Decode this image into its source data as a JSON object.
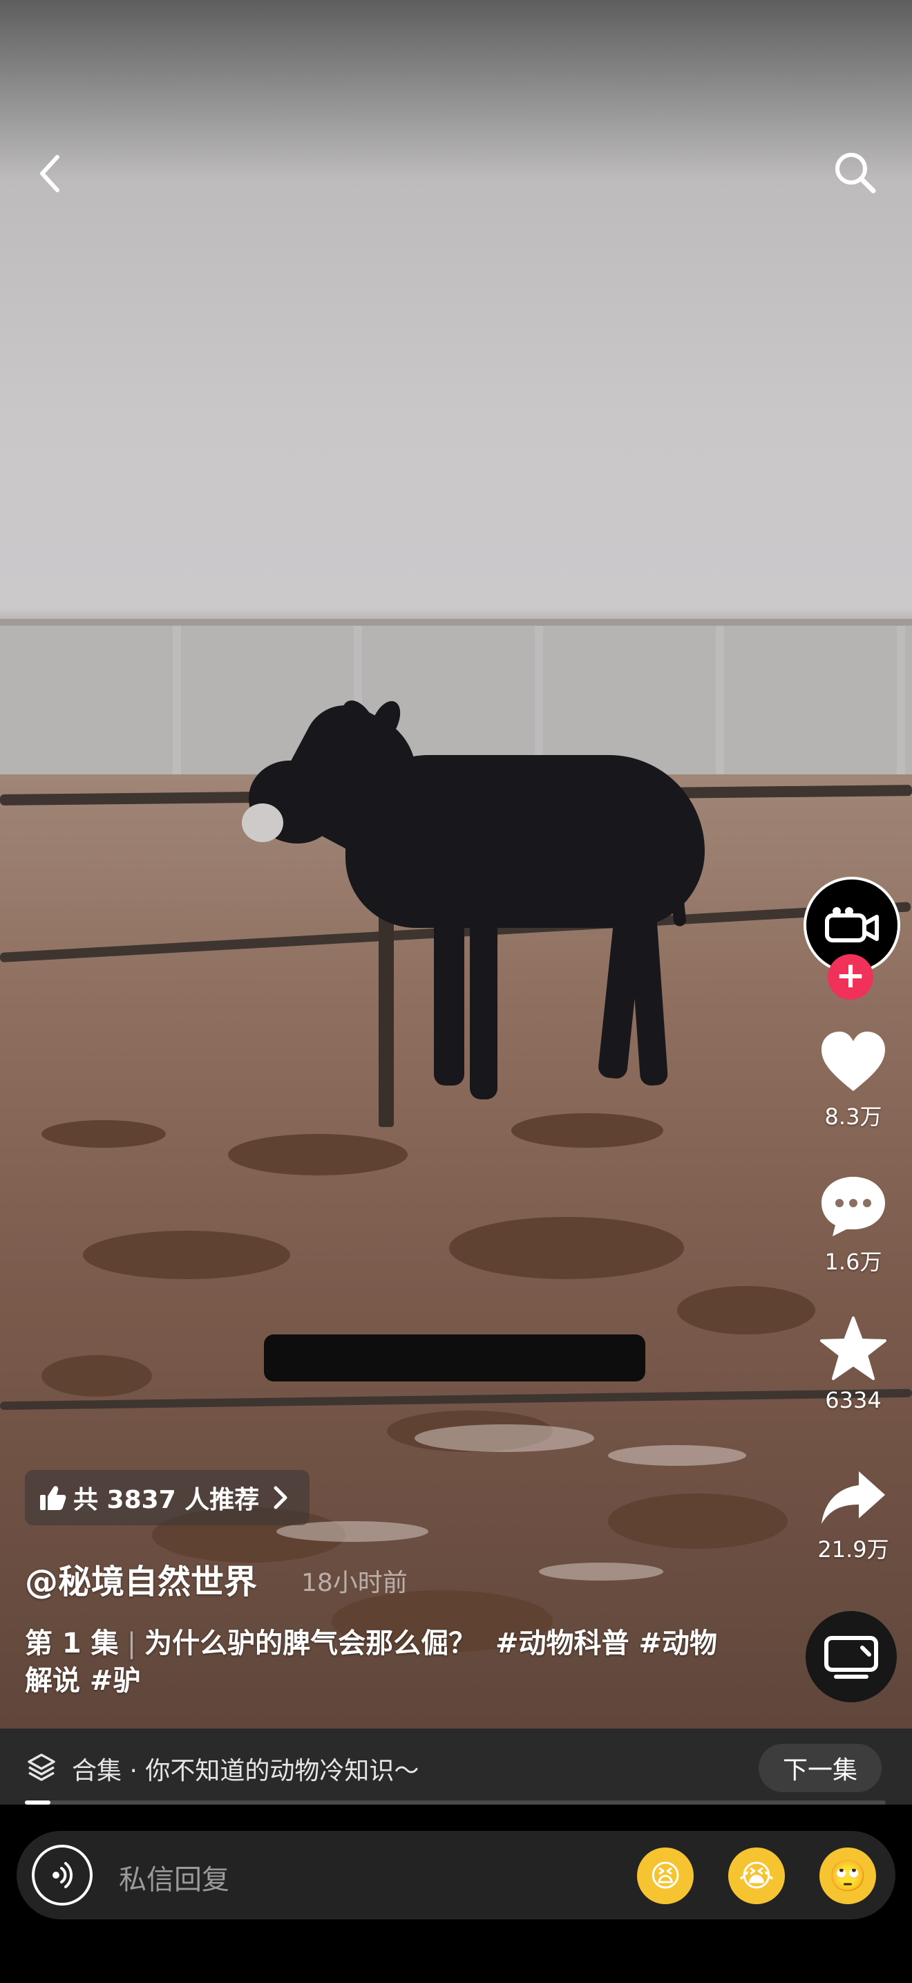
{
  "top_bar": {
    "back_icon": "chevron-left-icon",
    "search_icon": "search-icon"
  },
  "video": {
    "scene": "black donkey behind a fence in a muddy, rainy pen"
  },
  "right_rail": {
    "avatar_icon": "video-camera-icon",
    "follow_icon": "plus-icon",
    "like_count": "8.3万",
    "comment_count": "1.6万",
    "favorite_count": "6334",
    "share_count": "21.9万",
    "disc_icon": "tv-icon"
  },
  "recommend": {
    "text": "共 3837 人推荐",
    "icon": "thumbs-up-icon"
  },
  "author": {
    "name": "@秘境自然世界",
    "time": "18小时前"
  },
  "description": {
    "episode": "第 1 集",
    "title": "为什么驴的脾气会那么倔？",
    "hashtags": "#动物科普 #动物解说 #驴"
  },
  "collection": {
    "label": "合集 · 你不知道的动物冷知识～",
    "next_label": "下一集",
    "progress": 0.03
  },
  "reply": {
    "placeholder": "私信回复",
    "emojis": [
      "😫",
      "😭",
      "🙄"
    ]
  },
  "colors": {
    "accent": "#f0315a",
    "reply_bg": "#232323",
    "collection_bg": "#2a2a2a"
  }
}
